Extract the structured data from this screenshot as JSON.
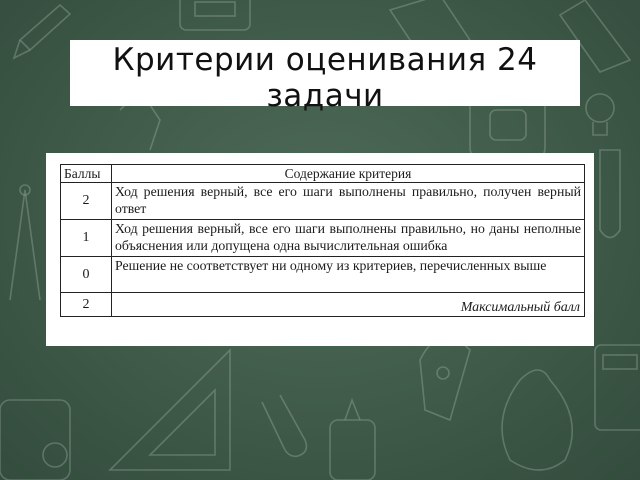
{
  "slide": {
    "title": "Критерии оценивания 24 задачи"
  },
  "table": {
    "header": {
      "score": "Баллы",
      "criterion": "Содержание критерия"
    },
    "rows": [
      {
        "score": "2",
        "text": "Ход решения верный, все его шаги выполнены правильно, получен верный ответ"
      },
      {
        "score": "1",
        "text": "Ход решения верный, все его шаги выполнены правильно, но даны неполные объяснения или допущена одна вычислительная ошибка"
      },
      {
        "score": "0",
        "text": "Решение не соответствует ни одному из критериев, перечисленных выше"
      }
    ],
    "max_row": {
      "score": "2",
      "label": "Максимальный балл"
    }
  }
}
